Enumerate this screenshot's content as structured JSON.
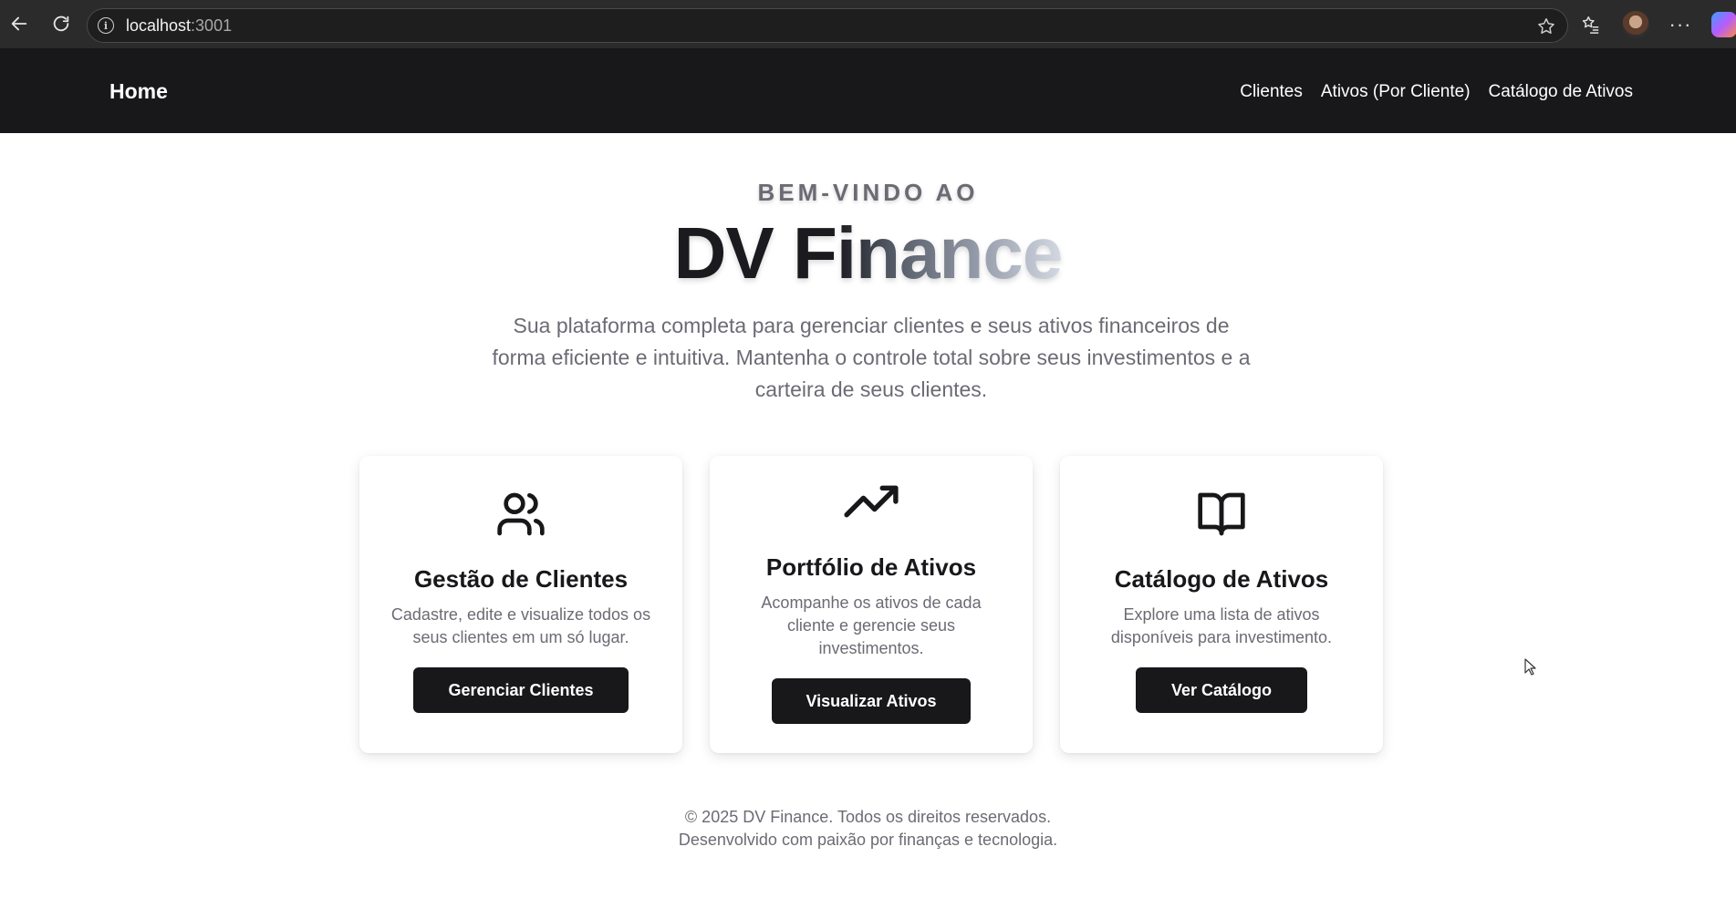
{
  "browser": {
    "url_host": "localhost",
    "url_port": ":3001"
  },
  "nav": {
    "home_label": "Home",
    "links": [
      "Clientes",
      "Ativos (Por Cliente)",
      "Catálogo de Ativos"
    ]
  },
  "hero": {
    "eyebrow": "BEM-VINDO AO",
    "title": "DV Finance",
    "description": "Sua plataforma completa para gerenciar clientes e seus ativos financeiros de forma eficiente e intuitiva. Mantenha o controle total sobre seus investimentos e a carteira de seus clientes."
  },
  "cards": [
    {
      "icon": "users-icon",
      "title": "Gestão de Clientes",
      "description": "Cadastre, edite e visualize todos os seus clientes em um só lugar.",
      "button": "Gerenciar Clientes"
    },
    {
      "icon": "trending-up-icon",
      "title": "Portfólio de Ativos",
      "description": "Acompanhe os ativos de cada cliente e gerencie seus investimentos.",
      "button": "Visualizar Ativos"
    },
    {
      "icon": "book-open-icon",
      "title": "Catálogo de Ativos",
      "description": "Explore uma lista de ativos disponíveis para investimento.",
      "button": "Ver Catálogo"
    }
  ],
  "footer": {
    "line1": "© 2025 DV Finance. Todos os direitos reservados.",
    "line2": "Desenvolvido com paixão por finanças e tecnologia."
  }
}
